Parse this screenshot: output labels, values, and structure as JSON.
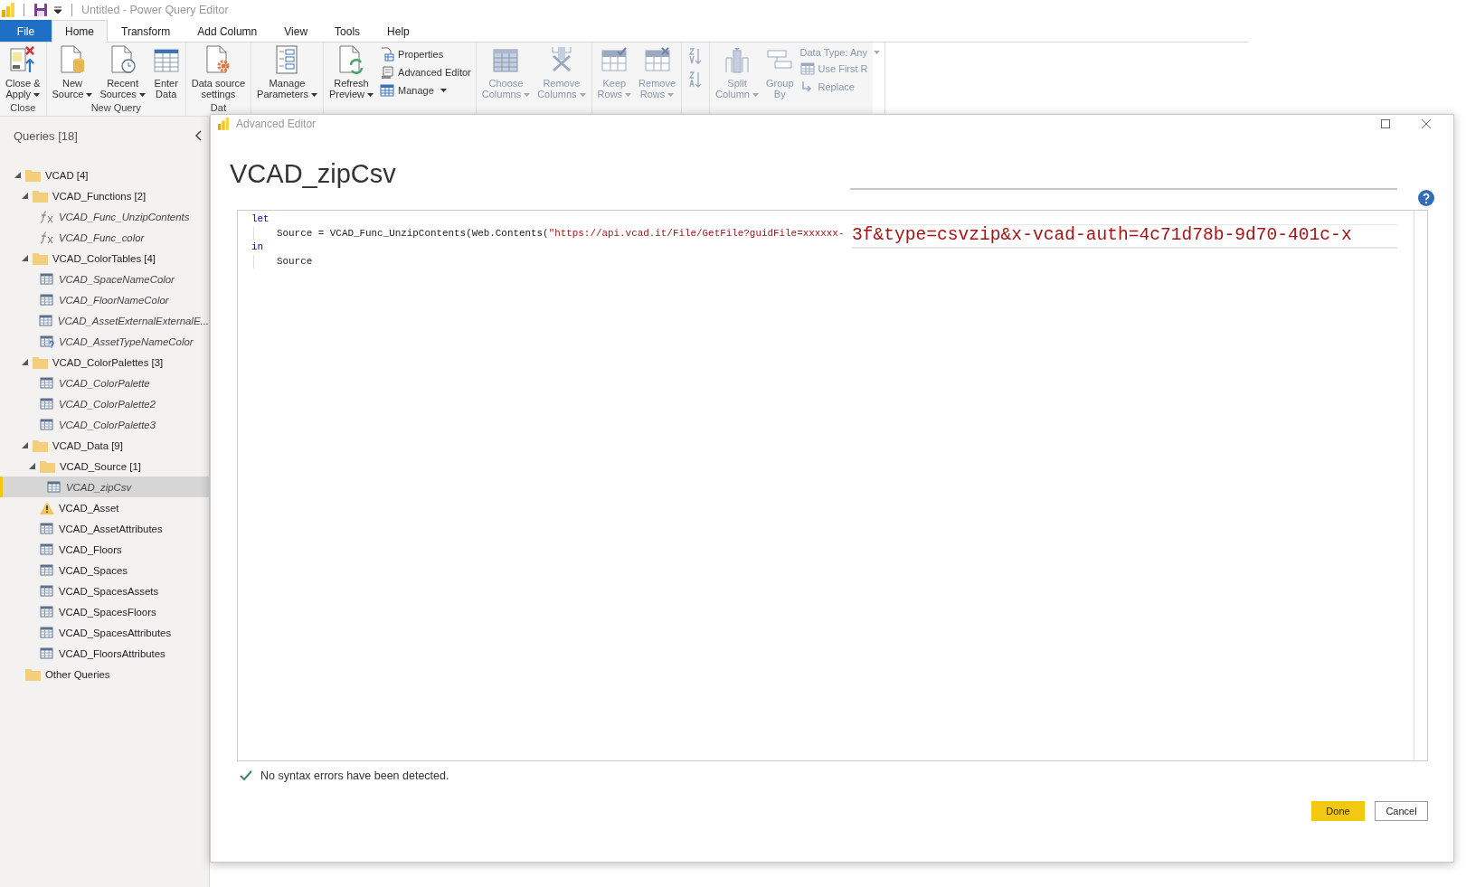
{
  "app": {
    "title": "Untitled - Power Query Editor"
  },
  "ribbon_tabs": [
    {
      "label": "File",
      "kind": "file",
      "selected": false
    },
    {
      "label": "Home",
      "kind": "tab",
      "selected": true
    },
    {
      "label": "Transform",
      "kind": "tab",
      "selected": false
    },
    {
      "label": "Add Column",
      "kind": "tab",
      "selected": false
    },
    {
      "label": "View",
      "kind": "tab",
      "selected": false
    },
    {
      "label": "Tools",
      "kind": "tab",
      "selected": false
    },
    {
      "label": "Help",
      "kind": "tab",
      "selected": false
    }
  ],
  "ribbon_groups": [
    {
      "label": "Close",
      "buttons": [
        {
          "kind": "large",
          "lines": [
            "Close &",
            "Apply"
          ],
          "dropdown": true,
          "disabled": false
        }
      ]
    },
    {
      "label": "New Query",
      "buttons": [
        {
          "kind": "large",
          "lines": [
            "New",
            "Source"
          ],
          "dropdown": true,
          "disabled": false
        },
        {
          "kind": "large",
          "lines": [
            "Recent",
            "Sources"
          ],
          "dropdown": true,
          "disabled": false
        },
        {
          "kind": "large",
          "lines": [
            "Enter",
            "Data"
          ],
          "dropdown": false,
          "disabled": false
        }
      ]
    },
    {
      "label": "Dat",
      "buttons": [
        {
          "kind": "large",
          "lines": [
            "Data source",
            "settings"
          ],
          "dropdown": false,
          "disabled": false
        }
      ]
    },
    {
      "buttons": [
        {
          "kind": "large",
          "lines": [
            "Manage",
            "Parameters"
          ],
          "dropdown": true,
          "disabled": false
        }
      ]
    },
    {
      "buttons": [
        {
          "kind": "large",
          "lines": [
            "Refresh",
            "Preview"
          ],
          "dropdown": true,
          "disabled": false
        },
        {
          "kind": "stack",
          "items": [
            {
              "label": "Properties",
              "dropdown": false,
              "disabled": false
            },
            {
              "label": "Advanced Editor",
              "dropdown": false,
              "disabled": false
            },
            {
              "label": "Manage",
              "dropdown": true,
              "disabled": false
            }
          ]
        }
      ]
    },
    {
      "buttons": [
        {
          "kind": "large",
          "lines": [
            "Choose",
            "Columns"
          ],
          "dropdown": true,
          "disabled": true
        },
        {
          "kind": "large",
          "lines": [
            "Remove",
            "Columns"
          ],
          "dropdown": true,
          "disabled": true
        }
      ]
    },
    {
      "buttons": [
        {
          "kind": "large",
          "lines": [
            "Keep",
            "Rows"
          ],
          "dropdown": true,
          "disabled": true
        },
        {
          "kind": "large",
          "lines": [
            "Remove",
            "Rows"
          ],
          "dropdown": true,
          "disabled": true
        }
      ]
    },
    {
      "buttons": [
        {
          "kind": "sort",
          "disabled": true
        }
      ]
    },
    {
      "buttons": [
        {
          "kind": "large",
          "lines": [
            "Split",
            "Column"
          ],
          "dropdown": true,
          "disabled": true
        },
        {
          "kind": "large",
          "lines": [
            "Group",
            "By"
          ],
          "dropdown": false,
          "disabled": true
        },
        {
          "kind": "stack",
          "items": [
            {
              "label": "Data Type: Any",
              "dropdown": true,
              "disabled": true
            },
            {
              "label": "Use First R",
              "dropdown": false,
              "disabled": true
            },
            {
              "label": "Replace",
              "dropdown": false,
              "disabled": true
            }
          ]
        }
      ]
    }
  ],
  "queries": {
    "title": "Queries [18]",
    "items": [
      {
        "kind": "folder",
        "label": "VCAD [4]",
        "expanded": true,
        "children": [
          {
            "kind": "folder",
            "label": "VCAD_Functions [2]",
            "expanded": true,
            "children": [
              {
                "kind": "function",
                "label": "VCAD_Func_UnzipContents",
                "load_disabled": true,
                "selected": false
              },
              {
                "kind": "function",
                "label": "VCAD_Func_color",
                "load_disabled": true,
                "selected": false
              }
            ]
          },
          {
            "kind": "folder",
            "label": "VCAD_ColorTables [4]",
            "expanded": true,
            "children": [
              {
                "kind": "table",
                "label": "VCAD_SpaceNameColor",
                "load_disabled": true,
                "selected": false
              },
              {
                "kind": "table",
                "label": "VCAD_FloorNameColor",
                "load_disabled": true,
                "selected": false
              },
              {
                "kind": "table",
                "label": "VCAD_AssetExternalExternalE...",
                "load_disabled": true,
                "selected": false
              },
              {
                "kind": "unknown",
                "label": "VCAD_AssetTypeNameColor",
                "load_disabled": true,
                "selected": false
              }
            ]
          },
          {
            "kind": "folder",
            "label": "VCAD_ColorPalettes [3]",
            "expanded": true,
            "children": [
              {
                "kind": "table",
                "label": "VCAD_ColorPalette",
                "load_disabled": true,
                "selected": false
              },
              {
                "kind": "table",
                "label": "VCAD_ColorPalette2",
                "load_disabled": true,
                "selected": false
              },
              {
                "kind": "table",
                "label": "VCAD_ColorPalette3",
                "load_disabled": true,
                "selected": false
              }
            ]
          },
          {
            "kind": "folder",
            "label": "VCAD_Data [9]",
            "expanded": true,
            "children": [
              {
                "kind": "folder",
                "label": "VCAD_Source [1]",
                "expanded": true,
                "children": [
                  {
                    "kind": "table",
                    "label": "VCAD_zipCsv",
                    "load_disabled": true,
                    "selected": true
                  }
                ]
              },
              {
                "kind": "warning",
                "label": "VCAD_Asset",
                "load_disabled": false,
                "selected": false
              },
              {
                "kind": "table",
                "label": "VCAD_AssetAttributes",
                "load_disabled": false,
                "selected": false
              },
              {
                "kind": "table",
                "label": "VCAD_Floors",
                "load_disabled": false,
                "selected": false
              },
              {
                "kind": "table",
                "label": "VCAD_Spaces",
                "load_disabled": false,
                "selected": false
              },
              {
                "kind": "table",
                "label": "VCAD_SpacesAssets",
                "load_disabled": false,
                "selected": false
              },
              {
                "kind": "table",
                "label": "VCAD_SpacesFloors",
                "load_disabled": false,
                "selected": false
              },
              {
                "kind": "table",
                "label": "VCAD_SpacesAttributes",
                "load_disabled": false,
                "selected": false
              },
              {
                "kind": "table",
                "label": "VCAD_FloorsAttributes",
                "load_disabled": false,
                "selected": false
              }
            ]
          }
        ]
      },
      {
        "kind": "folder",
        "label": "Other Queries"
      }
    ]
  },
  "dialog": {
    "title": "Advanced Editor",
    "heading": "VCAD_zipCsv",
    "code": [
      {
        "keyword": "let",
        "body": [
          {
            "kind": "plain",
            "text": "Source = VCAD_Func_UnzipContents(Web.Contents("
          },
          {
            "kind": "string",
            "text": "\"https://api.vcad.it/File/GetFile?guidFile=xxxxxx-"
          }
        ]
      },
      {
        "keyword": "in",
        "body": [
          {
            "kind": "plain",
            "text": "Source"
          }
        ]
      }
    ],
    "magnified_text": "3f&type=csvzip&x-vcad-auth=4c71d78b-9d70-401c-x",
    "status": "No syntax errors have been detected.",
    "buttons": [
      {
        "label": "Done",
        "kind": "primary"
      },
      {
        "label": "Cancel",
        "kind": "secondary"
      }
    ]
  }
}
